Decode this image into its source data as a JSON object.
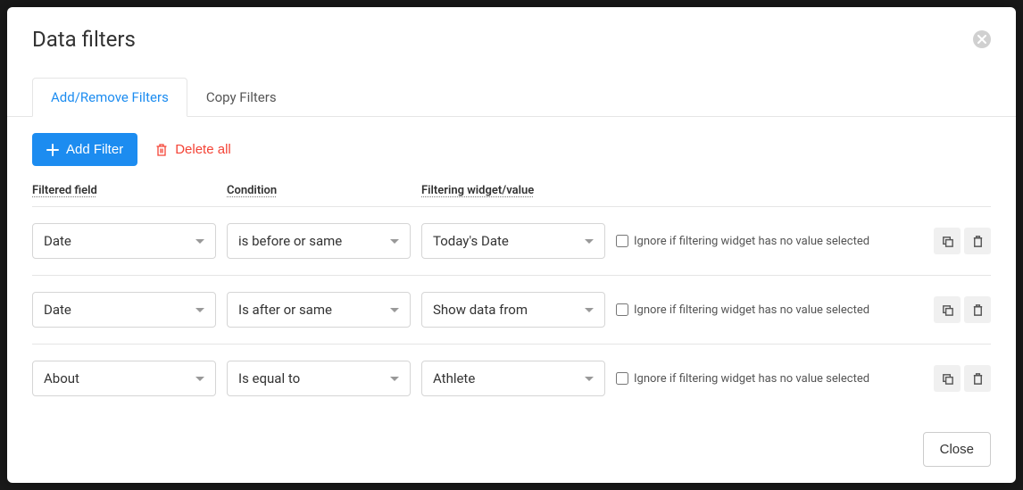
{
  "modal": {
    "title": "Data filters",
    "close_button_label": "Close"
  },
  "tabs": {
    "add_remove": "Add/Remove Filters",
    "copy": "Copy Filters"
  },
  "toolbar": {
    "add_filter_label": "Add Filter",
    "delete_all_label": "Delete all"
  },
  "columns": {
    "field": "Filtered field",
    "condition": "Condition",
    "value": "Filtering widget/value"
  },
  "ignore_label": "Ignore if filtering widget has no value selected",
  "rows": [
    {
      "field": "Date",
      "condition": "is before or same",
      "value": "Today's Date",
      "ignore": false
    },
    {
      "field": "Date",
      "condition": "Is after or same",
      "value": "Show data from",
      "ignore": false
    },
    {
      "field": "About",
      "condition": "Is equal to",
      "value": "Athlete",
      "ignore": false
    }
  ]
}
